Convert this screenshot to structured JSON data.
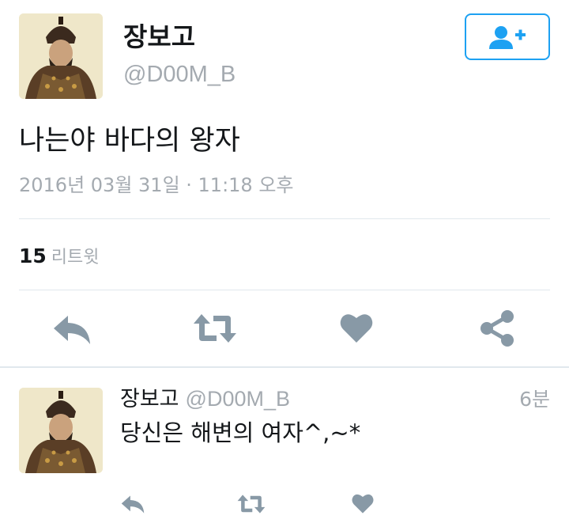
{
  "tweet": {
    "author": {
      "display_name": "장보고",
      "handle": "@D00M_B"
    },
    "follow_button": {
      "icon": "add-user-icon",
      "color": "#1da1f2"
    },
    "text": "나는야 바다의 왕자",
    "timestamp": "2016년 03월 31일 · 11:18 오후",
    "retweet_count": "15",
    "retweet_label": "리트윗",
    "actions": [
      "reply-icon",
      "retweet-icon",
      "like-icon",
      "share-icon"
    ],
    "action_color": "#8899a6"
  },
  "reply": {
    "author": {
      "display_name": "장보고",
      "handle": "@D00M_B"
    },
    "time_ago": "6분",
    "text": "당신은 해변의 여자^,~*",
    "actions": [
      "reply-icon",
      "retweet-icon",
      "like-icon"
    ]
  }
}
